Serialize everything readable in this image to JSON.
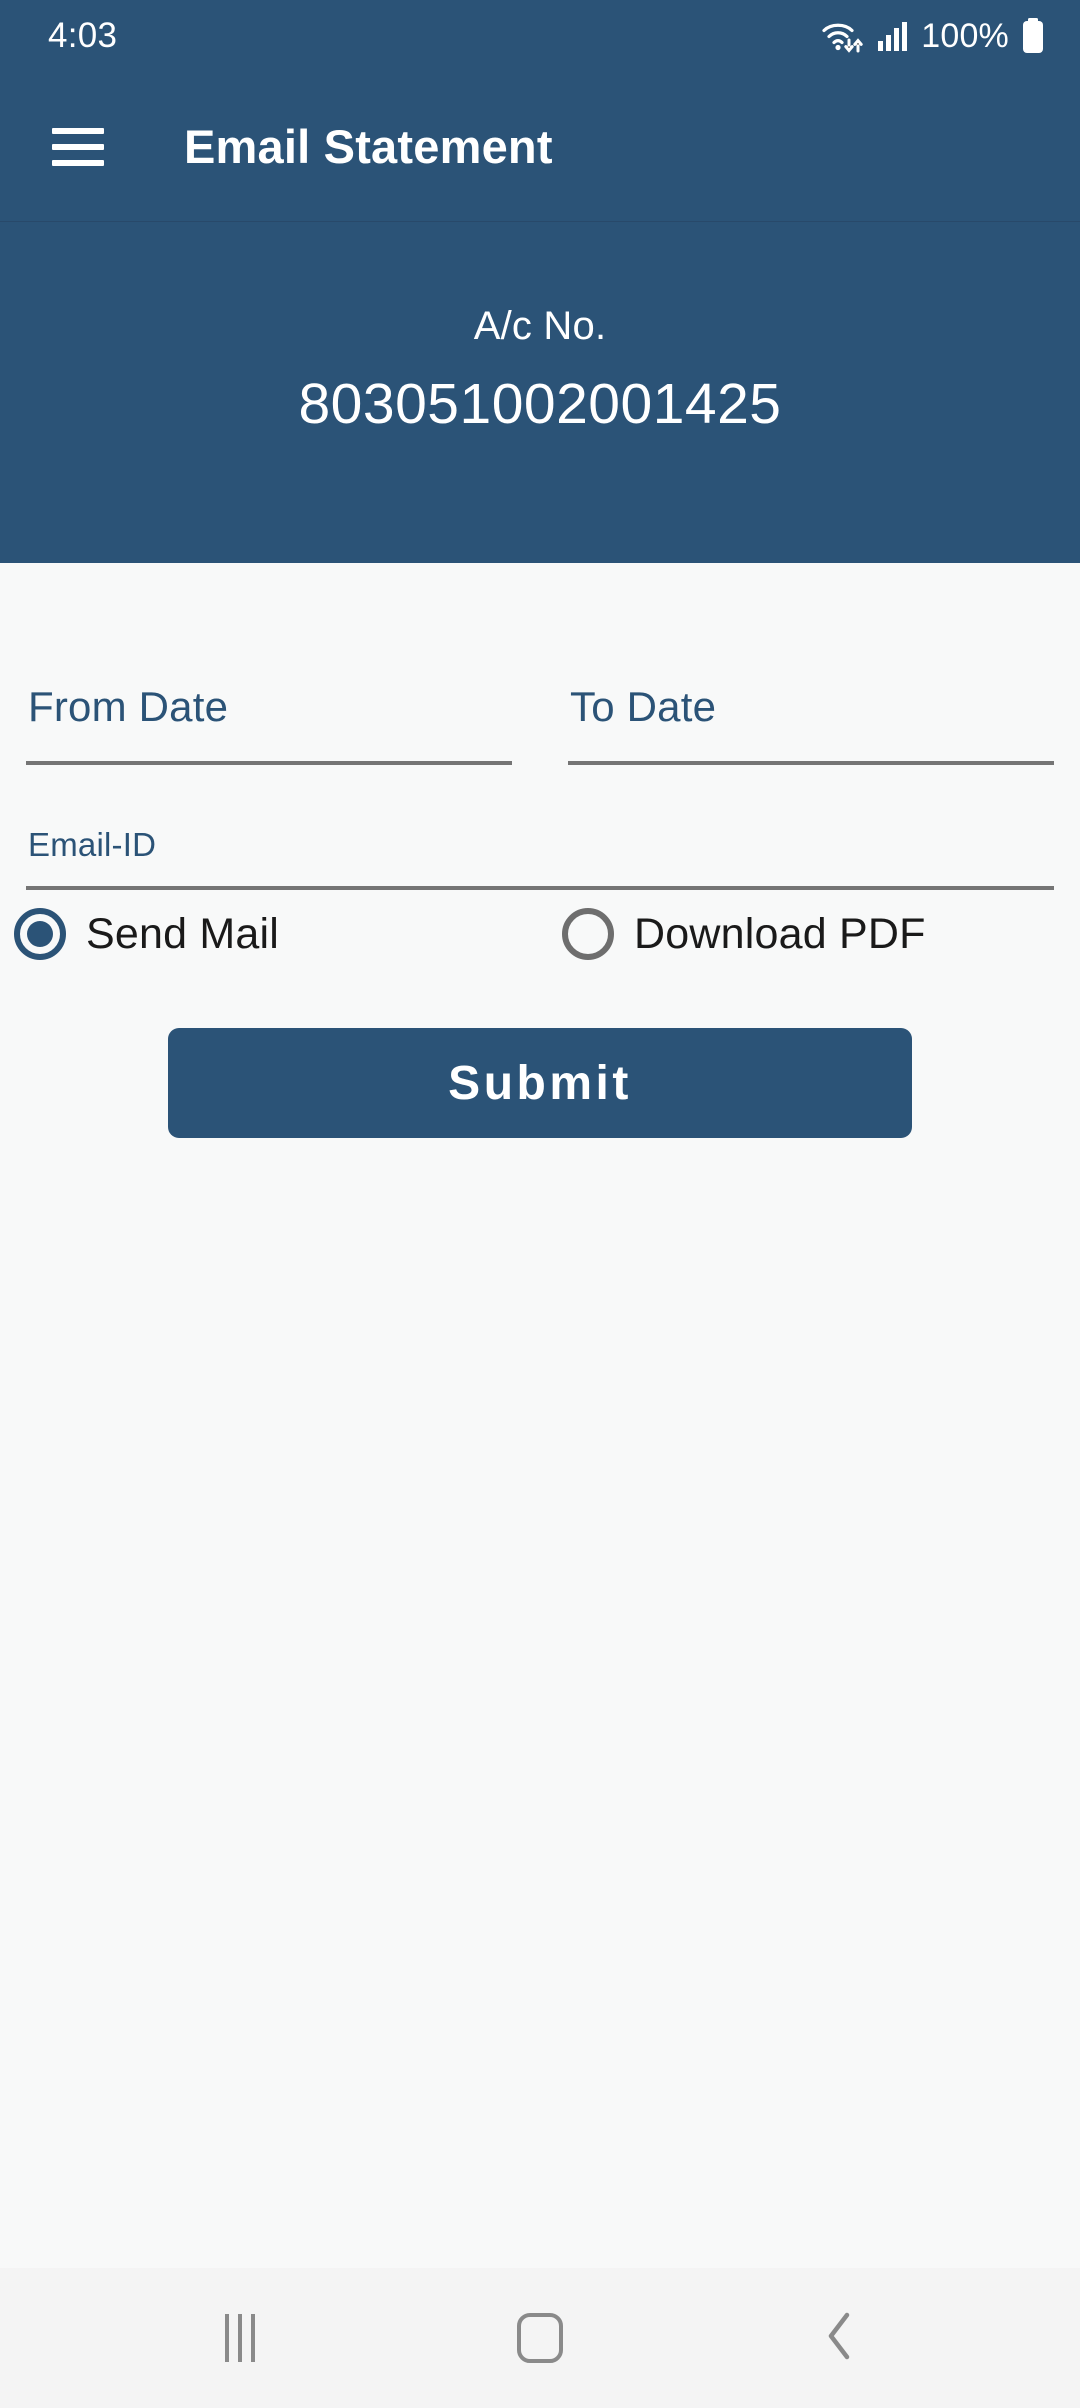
{
  "status_bar": {
    "time": "4:03",
    "battery_percent": "100%",
    "icons": [
      "wifi-icon",
      "cellular-signal-icon",
      "battery-icon"
    ]
  },
  "app_bar": {
    "menu_icon": "hamburger-menu-icon",
    "title": "Email Statement"
  },
  "account_panel": {
    "label": "A/c No.",
    "number": "803051002001425"
  },
  "form": {
    "from_date": {
      "placeholder": "From Date",
      "value": ""
    },
    "to_date": {
      "placeholder": "To Date",
      "value": ""
    },
    "email_id": {
      "placeholder": "Email-ID",
      "value": ""
    },
    "delivery_options": [
      {
        "label": "Send Mail",
        "selected": true
      },
      {
        "label": "Download PDF",
        "selected": false
      }
    ],
    "submit_label": "Submit"
  },
  "nav_bar": {
    "recents": "recents-icon",
    "home": "home-icon",
    "back": "back-icon"
  },
  "colors": {
    "primary": "#2b5377",
    "background": "#f8f9f9",
    "underline": "#757575",
    "nav_bar": "#f4f4f4",
    "radio_off": "#6e6e6e"
  }
}
